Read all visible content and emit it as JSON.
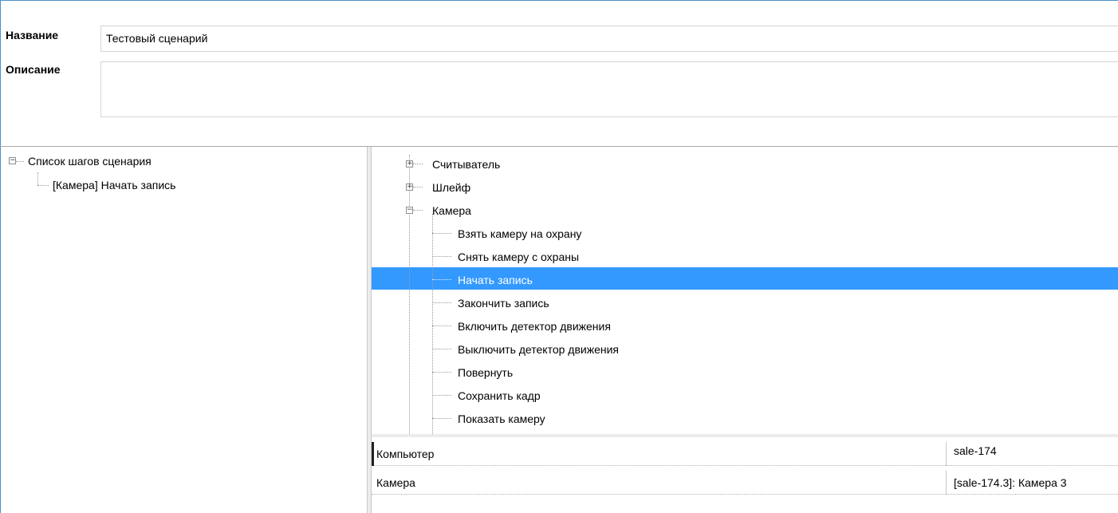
{
  "form": {
    "name_label": "Название",
    "name_value": "Тестовый сценарий",
    "description_label": "Описание",
    "description_value": ""
  },
  "left_tree": {
    "root_label": "Список шагов сценария",
    "steps": [
      "[Камера] Начать запись"
    ]
  },
  "right_tree": {
    "groups": [
      {
        "label": "Считыватель",
        "expanded": false
      },
      {
        "label": "Шлейф",
        "expanded": false
      },
      {
        "label": "Камера",
        "expanded": true
      }
    ],
    "camera_actions": [
      "Взять камеру на охрану",
      "Снять камеру с охраны",
      "Начать запись",
      "Закончить запись",
      "Включить детектор движения",
      "Выключить детектор движения",
      "Повернуть",
      "Сохранить кадр",
      "Показать камеру"
    ],
    "selected_action": "Начать запись",
    "selection_color": "#3399ff"
  },
  "properties": [
    {
      "name": "Компьютер",
      "value": "sale-174"
    },
    {
      "name": "Камера",
      "value": "[sale-174.3]: Камера 3"
    }
  ]
}
